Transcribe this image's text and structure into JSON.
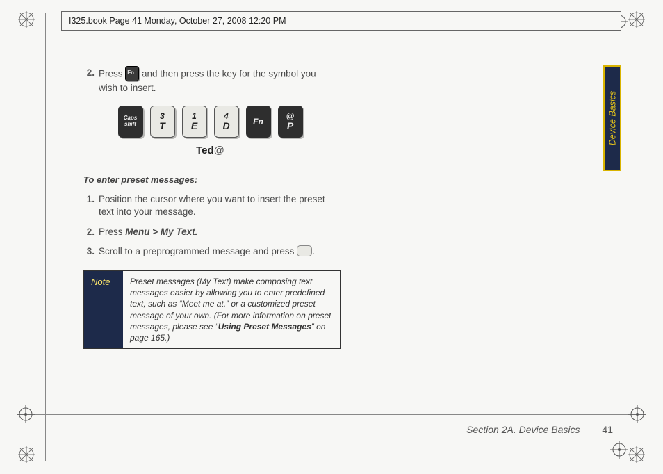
{
  "meta_header": "I325.book  Page 41  Monday, October 27, 2008  12:20 PM",
  "side_tab": "Device Basics",
  "step2": {
    "num": "2.",
    "text_a": "Press ",
    "text_b": " and then press the key for the symbol you wish to insert."
  },
  "keys": [
    {
      "style": "dark",
      "top": "Caps",
      "bot": "shift",
      "tinyTop": true,
      "tinyBot": true
    },
    {
      "style": "light",
      "top": "3",
      "bot": "T"
    },
    {
      "style": "light",
      "top": "1",
      "bot": "E"
    },
    {
      "style": "light",
      "top": "4",
      "bot": "D"
    },
    {
      "style": "dark",
      "top": "Fn",
      "bot": ""
    },
    {
      "style": "dark",
      "top": "@",
      "bot": "P"
    }
  ],
  "sample_output": {
    "text": "Ted",
    "suffix": "@"
  },
  "subheading": "To enter preset messages:",
  "preset_steps": [
    {
      "num": "1.",
      "text": "Position the cursor where you want to insert the preset text into your message."
    },
    {
      "num": "2.",
      "text_a": "Press ",
      "bold": "Menu > My Text."
    },
    {
      "num": "3.",
      "text_a": "Scroll to a preprogrammed message and press ",
      "text_b": "."
    }
  ],
  "note": {
    "label": "Note",
    "body_a": "Preset messages (My Text) make composing text messages easier by allowing you to enter predefined text, such as “Meet me at,” or a customized preset message of your own. (For more information on preset messages, please see “",
    "ref": "Using Preset Messages",
    "body_b": "” on page 165.)"
  },
  "footer": {
    "section": "Section 2A. Device Basics",
    "page": "41"
  }
}
